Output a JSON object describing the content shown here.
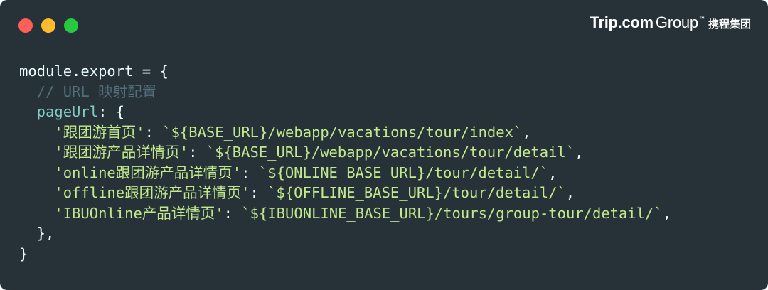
{
  "window": {
    "controls": [
      {
        "name": "close-dot",
        "color": "#ff5f56"
      },
      {
        "name": "minimize-dot",
        "color": "#ffbd2e"
      },
      {
        "name": "maximize-dot",
        "color": "#27c93f"
      }
    ]
  },
  "brand": {
    "name_bold": "Trip.com",
    "name_light": "Group",
    "trademark": "™",
    "chinese": "携程集团"
  },
  "code": {
    "lines": [
      [
        {
          "t": "module.export = {",
          "c": "plain"
        }
      ],
      [
        {
          "t": "  // URL 映射配置",
          "c": "comment"
        }
      ],
      [
        {
          "t": "  pageUrl",
          "c": "prop"
        },
        {
          "t": ": {",
          "c": "punct"
        }
      ],
      [
        {
          "t": "    '跟团游首页'",
          "c": "key"
        },
        {
          "t": ": ",
          "c": "punct"
        },
        {
          "t": "`${BASE_URL}/webapp/vacations/tour/index`",
          "c": "tmpl"
        },
        {
          "t": ",",
          "c": "punct"
        }
      ],
      [
        {
          "t": "    '跟团游产品详情页'",
          "c": "key"
        },
        {
          "t": ": ",
          "c": "punct"
        },
        {
          "t": "`${BASE_URL}/webapp/vacations/tour/detail`",
          "c": "tmpl"
        },
        {
          "t": ",",
          "c": "punct"
        }
      ],
      [
        {
          "t": "    'online跟团游产品详情页'",
          "c": "key"
        },
        {
          "t": ": ",
          "c": "punct"
        },
        {
          "t": "`${ONLINE_BASE_URL}/tour/detail/`",
          "c": "tmpl"
        },
        {
          "t": ",",
          "c": "punct"
        }
      ],
      [
        {
          "t": "    'offline跟团游产品详情页'",
          "c": "key"
        },
        {
          "t": ": ",
          "c": "punct"
        },
        {
          "t": "`${OFFLINE_BASE_URL}/tour/detail/`",
          "c": "tmpl"
        },
        {
          "t": ",",
          "c": "punct"
        }
      ],
      [
        {
          "t": "    'IBUOnline产品详情页'",
          "c": "key"
        },
        {
          "t": ": ",
          "c": "punct"
        },
        {
          "t": "`${IBUONLINE_BASE_URL}/tours/group-tour/detail/`",
          "c": "tmpl"
        },
        {
          "t": ",",
          "c": "punct"
        }
      ],
      [
        {
          "t": "  },",
          "c": "punct"
        }
      ],
      [
        {
          "t": "}",
          "c": "plain"
        }
      ]
    ]
  }
}
